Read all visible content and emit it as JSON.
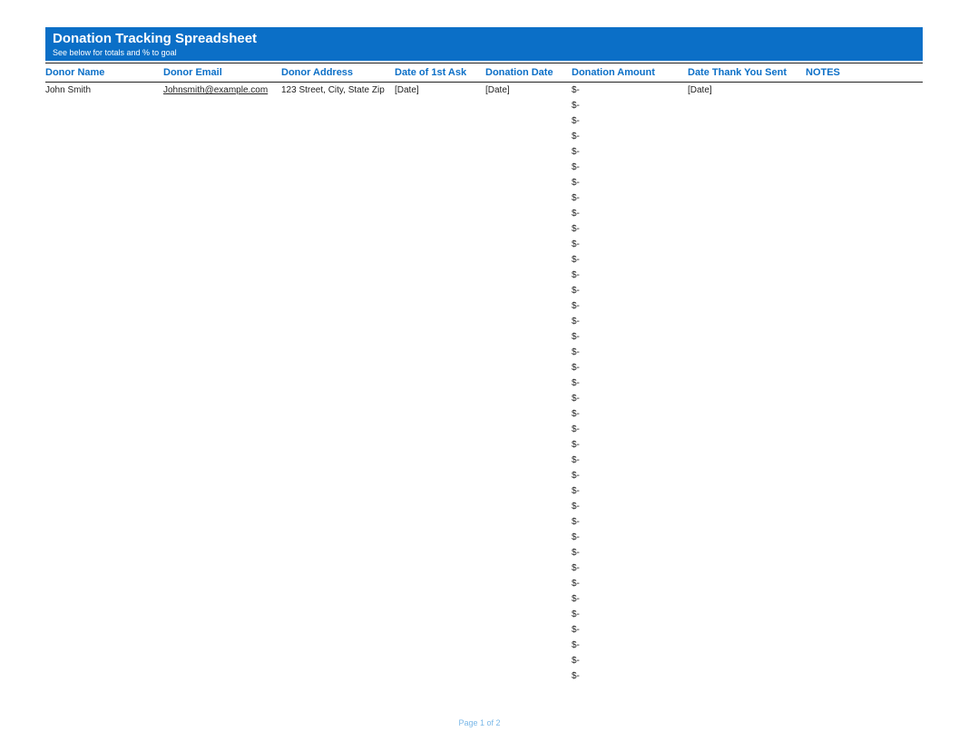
{
  "titleBar": {
    "title": "Donation Tracking Spreadsheet",
    "subtitle": "See below for totals and % to goal"
  },
  "columns": {
    "donorName": "Donor Name",
    "donorEmail": "Donor Email",
    "donorAddress": "Donor Address",
    "dateFirstAsk": "Date of 1st Ask",
    "donationDate": "Donation Date",
    "donationAmount": "Donation Amount",
    "dateThankYou": "Date Thank You Sent",
    "notes": "NOTES"
  },
  "rows": [
    {
      "donorName": "John Smith",
      "donorEmail": "Johnsmith@example.com",
      "donorAddress": "123 Street, City, State Zip",
      "dateFirstAsk": "[Date]",
      "donationDate": "[Date]",
      "donationAmount": "$-",
      "dateThankYou": "[Date]",
      "notes": ""
    },
    {
      "donationAmount": "$-"
    },
    {
      "donationAmount": "$-"
    },
    {
      "donationAmount": "$-"
    },
    {
      "donationAmount": "$-"
    },
    {
      "donationAmount": "$-"
    },
    {
      "donationAmount": "$-"
    },
    {
      "donationAmount": "$-"
    },
    {
      "donationAmount": "$-"
    },
    {
      "donationAmount": "$-"
    },
    {
      "donationAmount": "$-"
    },
    {
      "donationAmount": "$-"
    },
    {
      "donationAmount": "$-"
    },
    {
      "donationAmount": "$-"
    },
    {
      "donationAmount": "$-"
    },
    {
      "donationAmount": "$-"
    },
    {
      "donationAmount": "$-"
    },
    {
      "donationAmount": "$-"
    },
    {
      "donationAmount": "$-"
    },
    {
      "donationAmount": "$-"
    },
    {
      "donationAmount": "$-"
    },
    {
      "donationAmount": "$-"
    },
    {
      "donationAmount": "$-"
    },
    {
      "donationAmount": "$-"
    },
    {
      "donationAmount": "$-"
    },
    {
      "donationAmount": "$-"
    },
    {
      "donationAmount": "$-"
    },
    {
      "donationAmount": "$-"
    },
    {
      "donationAmount": "$-"
    },
    {
      "donationAmount": "$-"
    },
    {
      "donationAmount": "$-"
    },
    {
      "donationAmount": "$-"
    },
    {
      "donationAmount": "$-"
    },
    {
      "donationAmount": "$-"
    },
    {
      "donationAmount": "$-"
    },
    {
      "donationAmount": "$-"
    },
    {
      "donationAmount": "$-"
    },
    {
      "donationAmount": "$-"
    },
    {
      "donationAmount": "$-"
    }
  ],
  "footer": "Page 1 of 2"
}
